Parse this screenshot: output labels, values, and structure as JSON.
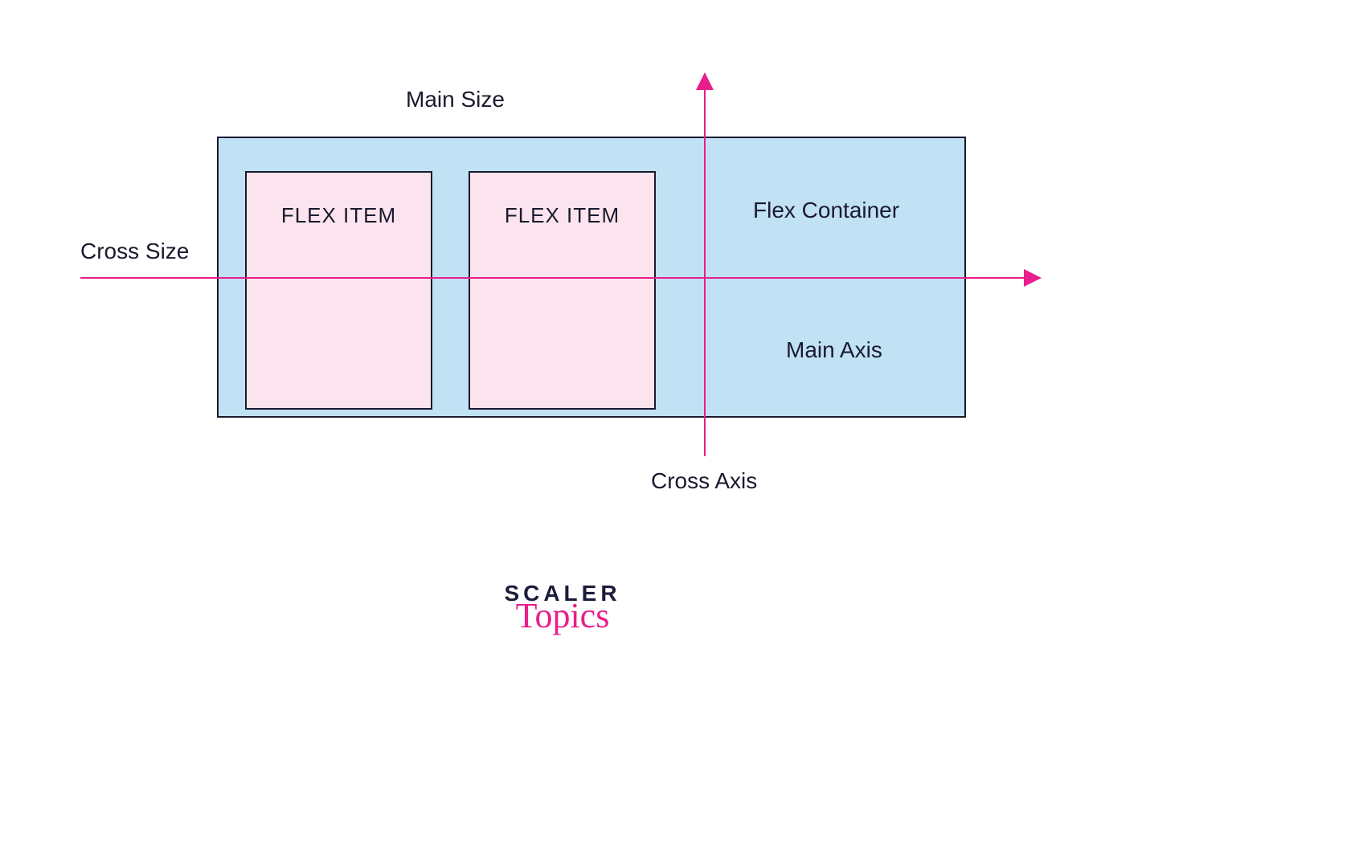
{
  "diagram": {
    "labels": {
      "main_size": "Main Size",
      "cross_size": "Cross Size",
      "flex_container": "Flex Container",
      "main_axis": "Main Axis",
      "cross_axis": "Cross Axis"
    },
    "items": {
      "item1": "FLEX ITEM",
      "item2": "FLEX ITEM"
    },
    "colors": {
      "container_fill": "#c1e1f5",
      "item_fill": "#fce4ee",
      "axis": "#e91e8c",
      "stroke": "#1a1a2e"
    }
  },
  "branding": {
    "line1": "SCALER",
    "line2": "Topics"
  }
}
